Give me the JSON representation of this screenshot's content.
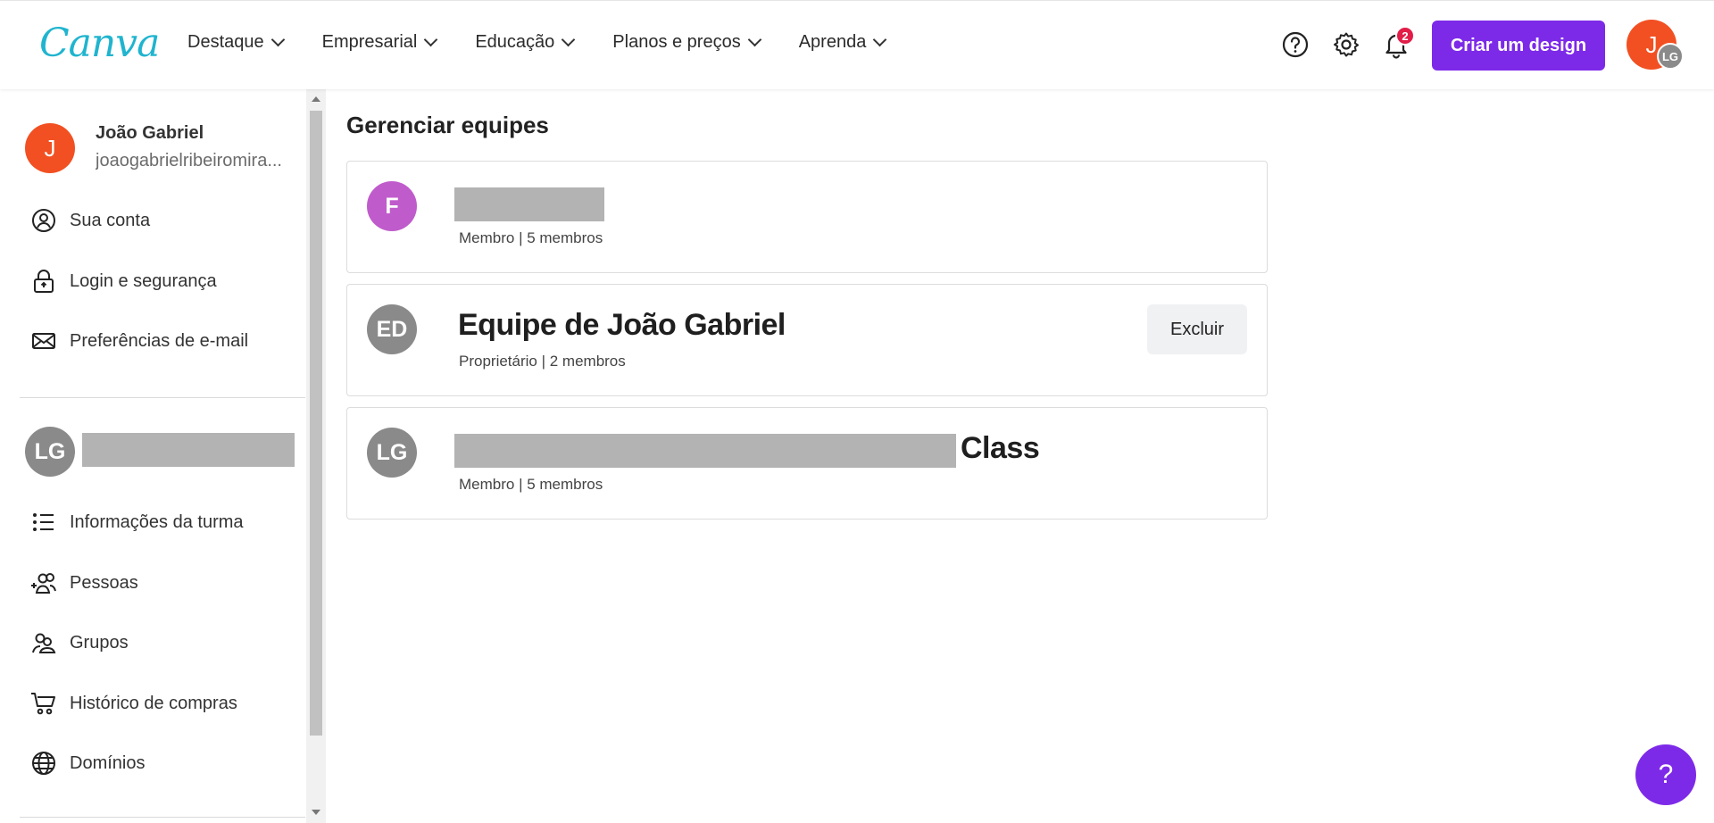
{
  "header": {
    "logo": "Canva",
    "nav": [
      {
        "label": "Destaque"
      },
      {
        "label": "Empresarial"
      },
      {
        "label": "Educação"
      },
      {
        "label": "Planos e preços"
      },
      {
        "label": "Aprenda"
      }
    ],
    "notification_count": "2",
    "create_button": "Criar um design",
    "avatar_initial": "J",
    "avatar_team_initials": "LG"
  },
  "sidebar": {
    "profile": {
      "initial": "J",
      "name": "João Gabriel",
      "email": "joaogabrielribeiromira..."
    },
    "account_items": [
      {
        "label": "Sua conta",
        "icon": "user-circle-icon"
      },
      {
        "label": "Login e segurança",
        "icon": "lock-icon"
      },
      {
        "label": "Preferências de e-mail",
        "icon": "envelope-icon"
      }
    ],
    "team": {
      "initials": "LG"
    },
    "team_items": [
      {
        "label": "Informações da turma",
        "icon": "list-icon"
      },
      {
        "label": "Pessoas",
        "icon": "add-people-icon"
      },
      {
        "label": "Grupos",
        "icon": "group-icon"
      },
      {
        "label": "Histórico de compras",
        "icon": "cart-icon"
      },
      {
        "label": "Domínios",
        "icon": "globe-icon"
      }
    ]
  },
  "main": {
    "title": "Gerenciar equipes",
    "teams": [
      {
        "initials": "F",
        "name": "",
        "meta": "Membro | 5 membros",
        "avatar_color": "#c05bcc"
      },
      {
        "initials": "ED",
        "name": "Equipe de João Gabriel",
        "meta": "Proprietário | 2 membros",
        "action": "Excluir",
        "avatar_color": "#8a8a8a"
      },
      {
        "initials": "LG",
        "name_suffix": "Class",
        "meta": "Membro | 5 membros",
        "avatar_color": "#8a8a8a"
      }
    ]
  },
  "help_button": "?",
  "colors": {
    "brand_purple": "#7d2ae8",
    "logo_teal": "#20b4cf",
    "avatar_orange": "#f25022",
    "badge_red": "#e11d48"
  }
}
